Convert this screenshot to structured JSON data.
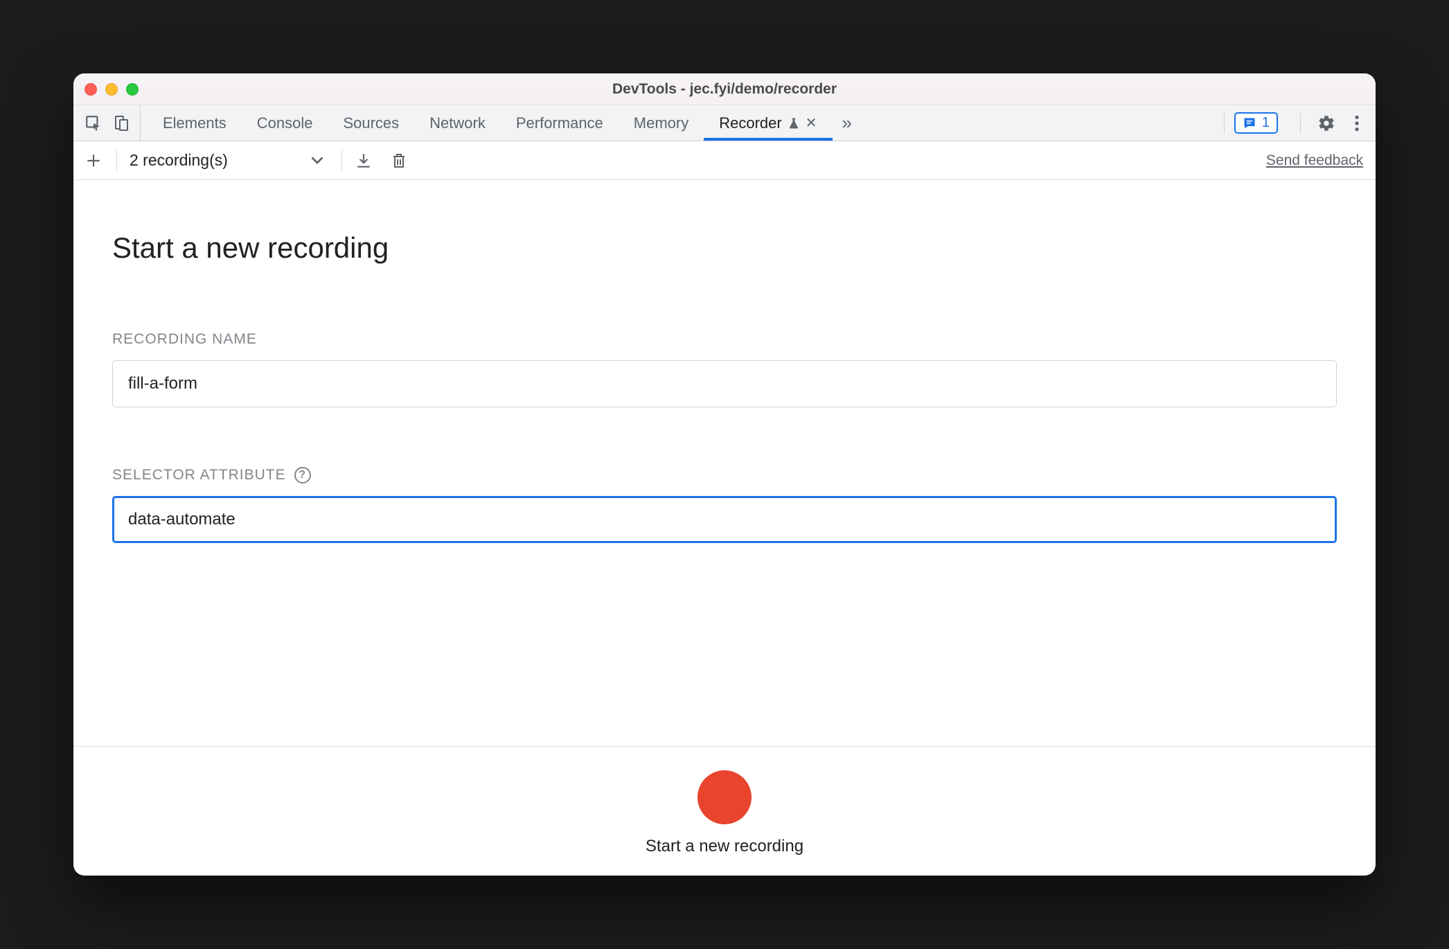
{
  "titlebar": {
    "title": "DevTools - jec.fyi/demo/recorder"
  },
  "tabs": {
    "items": [
      "Elements",
      "Console",
      "Sources",
      "Network",
      "Performance",
      "Memory"
    ],
    "recorder": "Recorder",
    "issuesCount": "1"
  },
  "subtoolbar": {
    "recordingsLabel": "2 recording(s)",
    "feedback": "Send feedback"
  },
  "form": {
    "heading": "Start a new recording",
    "nameLabel": "RECORDING NAME",
    "nameValue": "fill-a-form",
    "selectorLabel": "SELECTOR ATTRIBUTE",
    "selectorValue": "data-automate"
  },
  "footer": {
    "label": "Start a new recording"
  }
}
